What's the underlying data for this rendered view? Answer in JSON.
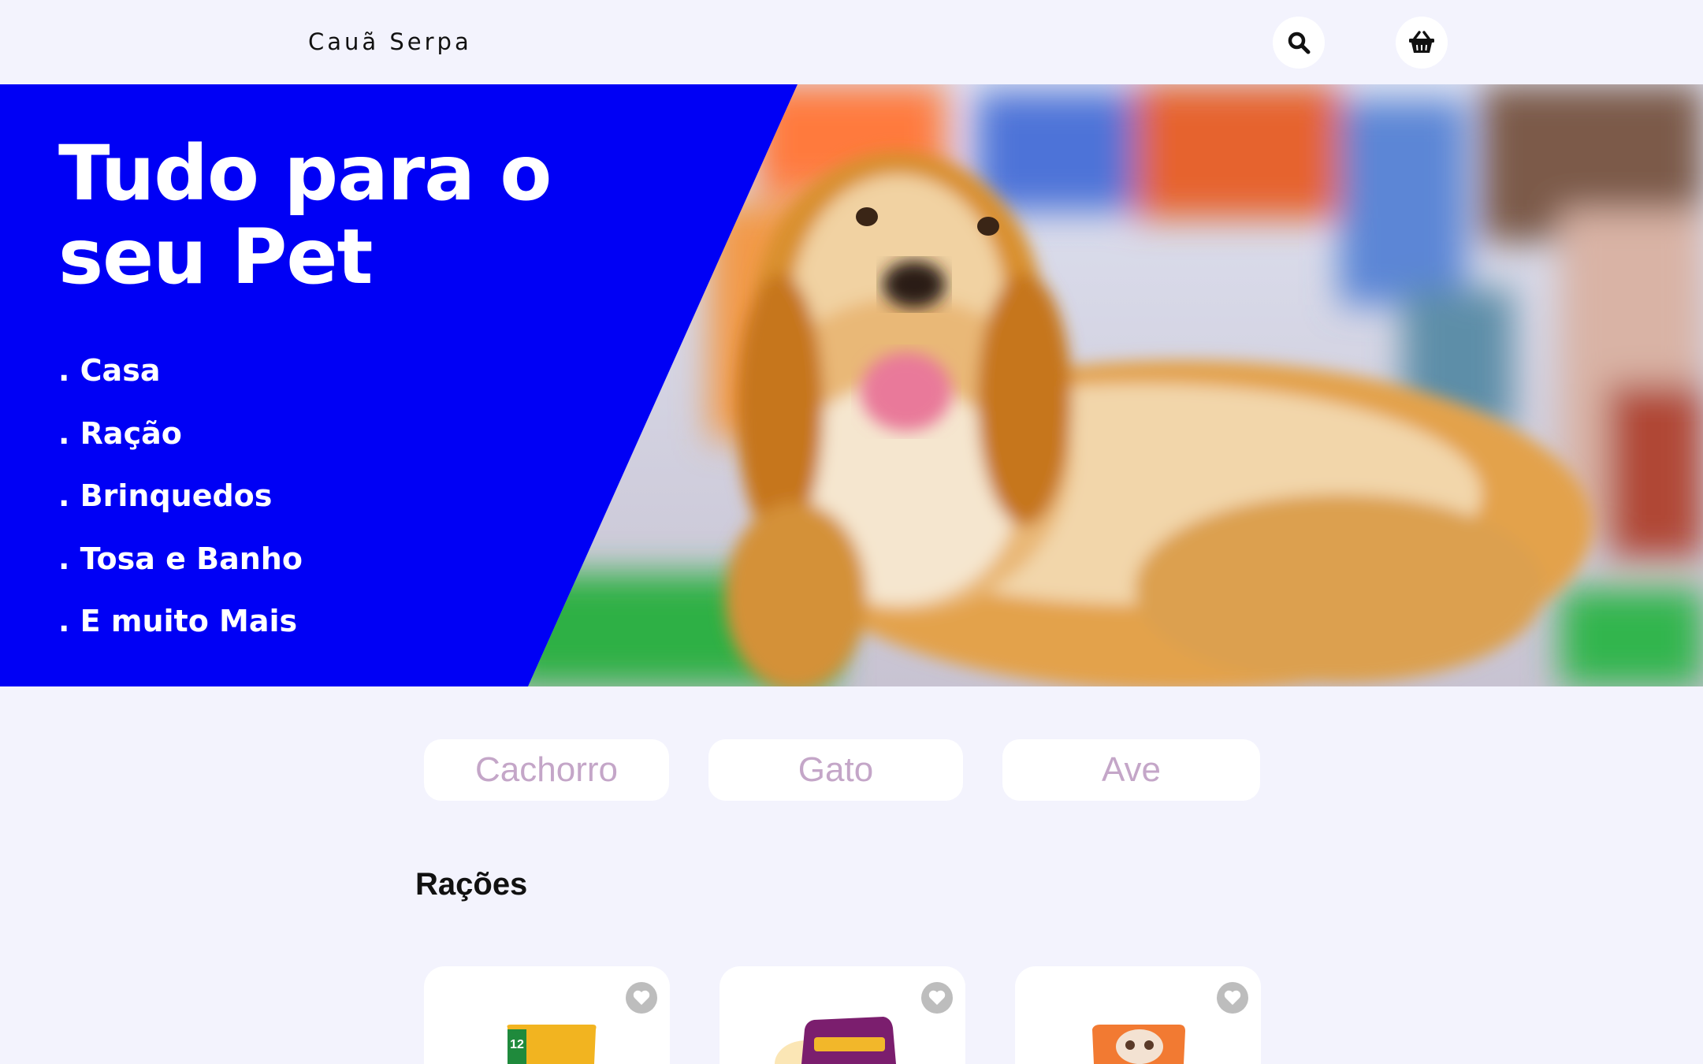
{
  "header": {
    "brand": "Cauã Serpa",
    "icons": [
      "search-icon",
      "basket-icon"
    ]
  },
  "hero": {
    "title": "Tudo para o seu Pet",
    "items": [
      ". Casa",
      ". Ração",
      ". Brinquedos",
      ". Tosa e Banho",
      ". E muito Mais"
    ],
    "background_color": "#0000f5"
  },
  "categories": [
    "Cachorro",
    "Gato",
    "Ave"
  ],
  "section": {
    "title": "Rações"
  },
  "products": [
    {
      "favorite_icon": "heart-icon"
    },
    {
      "favorite_icon": "heart-icon"
    },
    {
      "favorite_icon": "heart-icon"
    }
  ],
  "colors": {
    "page_bg": "#f3f3fd",
    "hero_blue": "#0000f5",
    "pill_text": "#c4a6c8"
  }
}
